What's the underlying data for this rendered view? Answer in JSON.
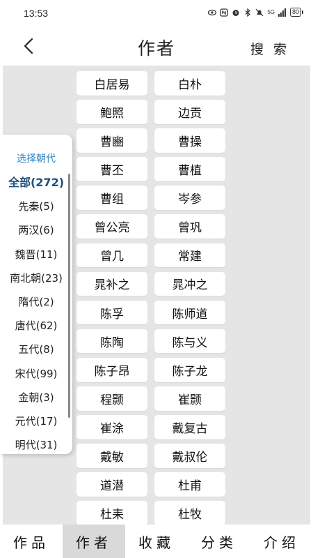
{
  "status": {
    "time": "13:53",
    "network": "5G",
    "battery": "80"
  },
  "header": {
    "title": "作者",
    "search_label": "搜 索"
  },
  "dynasty_panel": {
    "title": "选择朝代",
    "items": [
      {
        "label": "全部(272)",
        "active": true
      },
      {
        "label": "先秦(5)"
      },
      {
        "label": "两汉(6)"
      },
      {
        "label": "魏晋(11)"
      },
      {
        "label": "南北朝(23)"
      },
      {
        "label": "隋代(2)"
      },
      {
        "label": "唐代(62)"
      },
      {
        "label": "五代(8)"
      },
      {
        "label": "宋代(99)"
      },
      {
        "label": "金朝(3)"
      },
      {
        "label": "元代(17)"
      },
      {
        "label": "明代(31)"
      }
    ]
  },
  "authors": [
    "白居易",
    "白朴",
    "鲍照",
    "边贡",
    "曹豳",
    "曹操",
    "曹丕",
    "曹植",
    "曹组",
    "岑参",
    "曾公亮",
    "曾巩",
    "曾几",
    "常建",
    "晁补之",
    "晁冲之",
    "陈孚",
    "陈师道",
    "陈陶",
    "陈与义",
    "陈子昂",
    "陈子龙",
    "程颢",
    "崔颢",
    "崔涂",
    "戴复古",
    "戴敏",
    "戴叔伦",
    "道潜",
    "杜甫",
    "杜耒",
    "杜牧"
  ],
  "bottom_nav": {
    "tabs": [
      {
        "label": "作品"
      },
      {
        "label": "作者",
        "active": true
      },
      {
        "label": "收藏"
      },
      {
        "label": "分类"
      },
      {
        "label": "介绍"
      }
    ]
  },
  "colors": {
    "accent_blue": "#2e86c1",
    "active_dark_blue": "#1f4f7a",
    "content_bg": "#e5e5e5",
    "active_tab_bg": "#d9d9d9"
  }
}
